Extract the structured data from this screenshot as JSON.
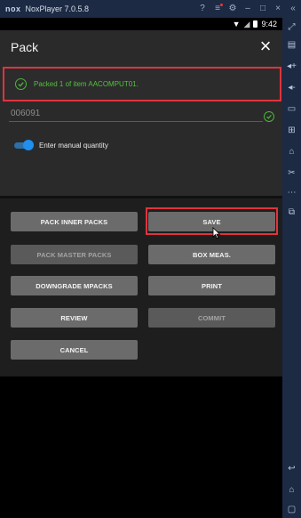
{
  "window": {
    "logo": "nox",
    "title": "NoxPlayer 7.0.5.8",
    "controls": [
      "help-icon",
      "menu-icon",
      "settings-icon",
      "minimize-icon",
      "maximize-icon",
      "close-icon",
      "collapse-icon"
    ]
  },
  "status_bar": {
    "time": "9:42"
  },
  "app_bar": {
    "title": "Pack",
    "close_icon": "×"
  },
  "toast": {
    "message": "Packed 1 of item AACOMPUT01."
  },
  "form": {
    "field_value": "006091",
    "toggle_label": "Enter manual quantity",
    "toggle_on": true
  },
  "buttons": {
    "pack_inner_packs": "PACK INNER PACKS",
    "save": "SAVE",
    "pack_master_packs": "PACK MASTER PACKS",
    "box_meas": "BOX MEAS.",
    "downgrade_mpacks": "DOWNGRADE MPACKS",
    "print": "PRINT",
    "review": "REVIEW",
    "commit": "COMMIT",
    "cancel": "CANCEL"
  },
  "colors": {
    "highlight_red": "#e0333d",
    "success_green": "#4cb63a",
    "toggle_blue": "#1f8ff0",
    "emulator_frame": "#1d2a44"
  },
  "sidebar_icons": [
    "expand-icon",
    "keyboard-icon",
    "volume-up-icon",
    "volume-down-icon",
    "screen-icon",
    "import-icon",
    "apk-icon",
    "scissors-icon",
    "more-icon",
    "external-icon",
    "back-icon",
    "home-icon",
    "recents-icon"
  ]
}
